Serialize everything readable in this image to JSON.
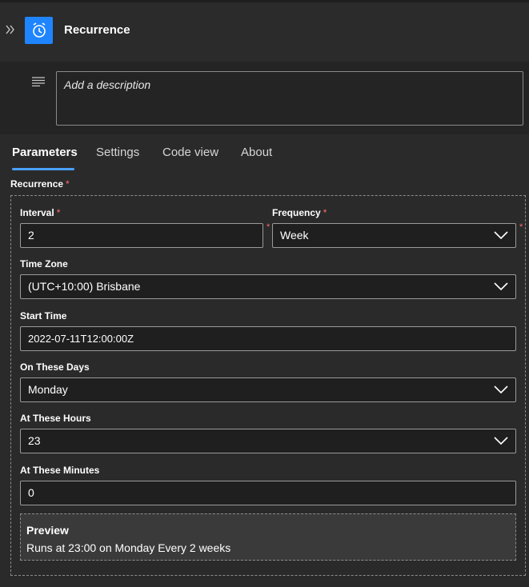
{
  "header": {
    "title": "Recurrence",
    "icon": "alarm-clock-icon",
    "icon_bg": "#1f85ff"
  },
  "description": {
    "placeholder": "Add a description"
  },
  "tabs": [
    {
      "label": "Parameters",
      "active": true
    },
    {
      "label": "Settings",
      "active": false
    },
    {
      "label": "Code view",
      "active": false
    },
    {
      "label": "About",
      "active": false
    }
  ],
  "section": {
    "label": "Recurrence",
    "required_mark": "*"
  },
  "fields": {
    "interval": {
      "label": "Interval",
      "required_mark": "*",
      "value": "2"
    },
    "frequency": {
      "label": "Frequency",
      "required_mark": "*",
      "value": "Week"
    },
    "time_zone": {
      "label": "Time Zone",
      "value": "(UTC+10:00) Brisbane"
    },
    "start_time": {
      "label": "Start Time",
      "value": "2022-07-11T12:00:00Z"
    },
    "on_these_days": {
      "label": "On These Days",
      "value": "Monday"
    },
    "at_these_hours": {
      "label": "At These Hours",
      "value": "23"
    },
    "at_these_minutes": {
      "label": "At These Minutes",
      "value": "0"
    }
  },
  "preview": {
    "title": "Preview",
    "text": "Runs at 23:00 on Monday Every 2 weeks"
  },
  "colors": {
    "accent": "#4aa0ff",
    "required": "#ff6b6b"
  }
}
